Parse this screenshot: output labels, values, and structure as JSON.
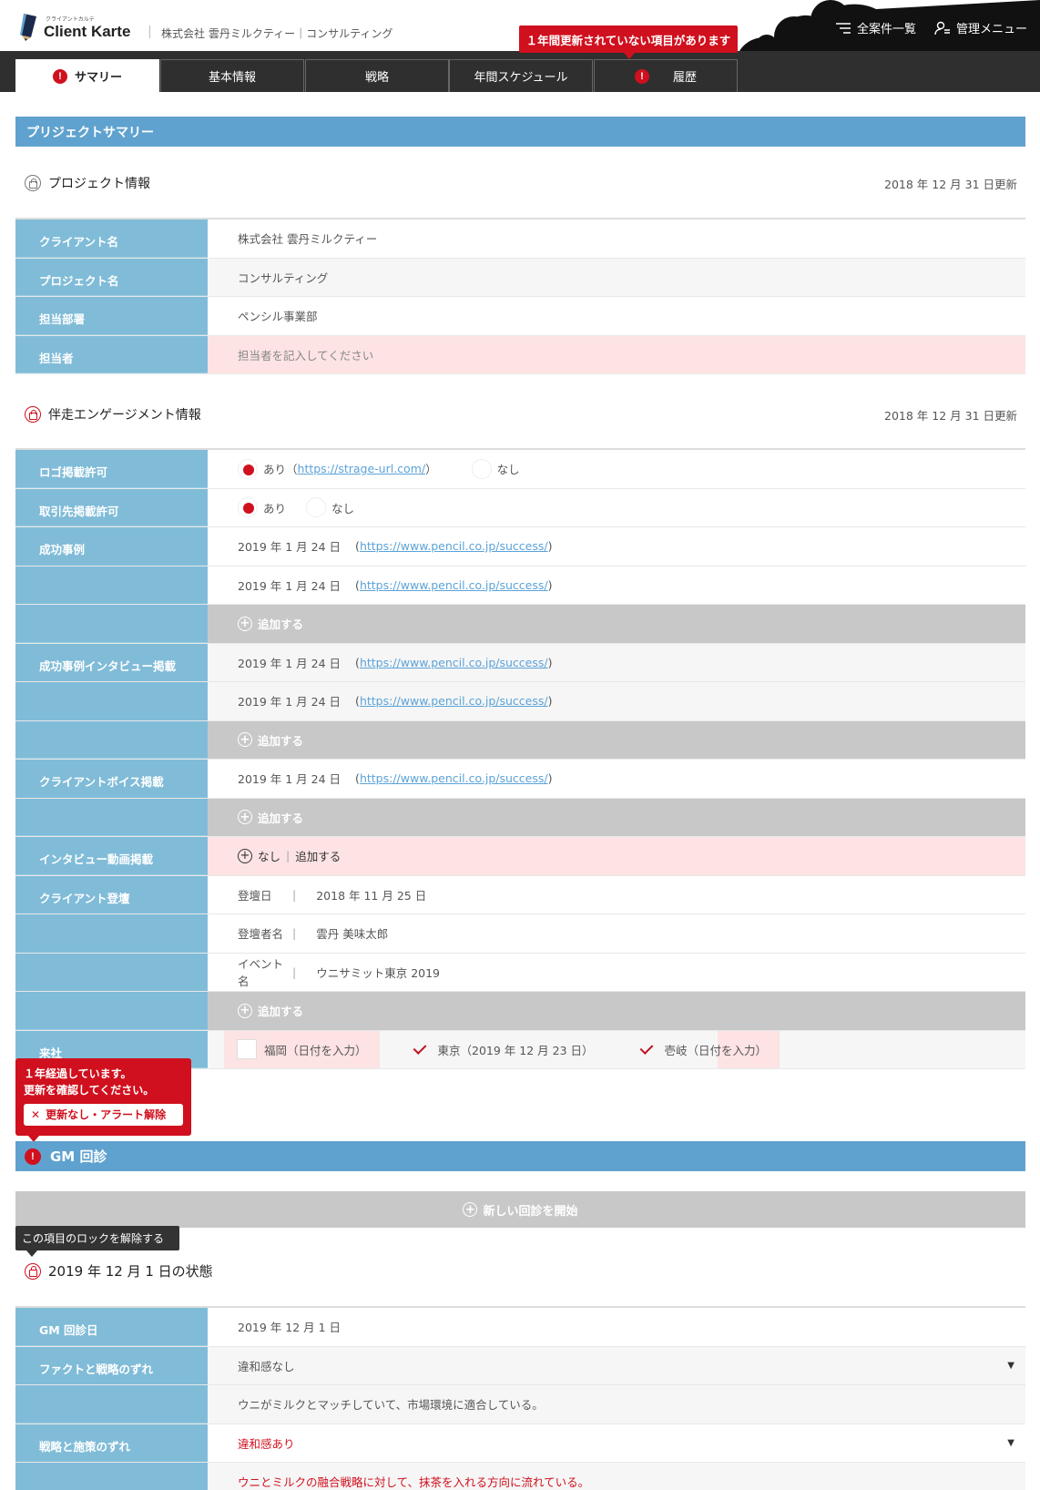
{
  "header": {
    "logo_small": "クライアントカルテ",
    "logo_text": "Client Karte",
    "subtitle": "株式会社 雲丹ミルクティー｜コンサルティング",
    "menu_all": "全案件一覧",
    "menu_admin": "管理メニュー"
  },
  "alert_banner": "１年間更新されていない項目があります",
  "tabs": [
    {
      "label": "サマリー",
      "alert": true
    },
    {
      "label": "基本情報",
      "alert": false
    },
    {
      "label": "戦略",
      "alert": false
    },
    {
      "label": "年間スケジュール",
      "alert": false
    },
    {
      "label": "履歴",
      "alert": true
    }
  ],
  "summary_title": "プリジェクトサマリー",
  "project": {
    "heading": "プロジェクト情報",
    "updated": "2018 年 12 月 31 日更新",
    "rows": [
      {
        "label": "クライアント名",
        "value": "株式会社 雲丹ミルクティー"
      },
      {
        "label": "プロジェクト名",
        "value": "コンサルティング"
      },
      {
        "label": "担当部署",
        "value": "ペンシル事業部"
      },
      {
        "label": "担当者",
        "value": "担当者を記入してください"
      }
    ]
  },
  "engagement": {
    "heading": "伴走エンゲージメント情報",
    "updated": "2018 年 12 月 31 日更新",
    "logo_label": "ロゴ掲載許可",
    "logo_yes": "あり（",
    "logo_url": "https://strage-url.com/",
    "logo_close": "）",
    "logo_no": "なし",
    "partner_label": "取引先掲載許可",
    "partner_yes": "あり",
    "partner_no": "なし",
    "success_label": "成功事例",
    "interview_label": "成功事例インタビュー掲載",
    "voice_label": "クライアントボイス掲載",
    "entry_date": "2019 年 1 月 24 日",
    "entry_url": "https://www.pencil.co.jp/success/",
    "add": "追加する",
    "video_label": "インタビュー動画掲載",
    "video_none": "なし",
    "video_add": "追加する",
    "stage_label": "クライアント登壇",
    "stage_rows": [
      {
        "k": "登壇日",
        "v": "2018 年 11 月 25 日"
      },
      {
        "k": "登壇者名",
        "v": "雲丹 美味太郎"
      },
      {
        "k": "イベント名",
        "v": "ウニサミット東京 2019"
      }
    ],
    "visit_label": "来社",
    "visits": [
      {
        "text": "福岡（日付を入力）",
        "checked": false
      },
      {
        "text": "東京（2019 年 12 月 23 日）",
        "checked": true
      },
      {
        "text": "壱岐（日付を入力）",
        "checked": true
      }
    ]
  },
  "warning": {
    "line1": "１年経過しています。",
    "line2": "更新を確認してください。",
    "button": "更新なし・アラート解除"
  },
  "gm": {
    "title": "GM 回診",
    "new_button": "新しい回診を開始",
    "unlock_tip": "この項目のロックを解除する",
    "state_heading": "2019 年 12 月 1 日の状態",
    "date_label": "GM 回診日",
    "date_value": "2019 年 12 月 1 日",
    "fact_label": "ファクトと戦略のずれ",
    "fact_value": "違和感なし",
    "fact_note": "ウニがミルクとマッチしていて、市場環境に適合している。",
    "measure_label": "戦略と施策のずれ",
    "measure_value": "違和感あり",
    "measure_note": "ウニとミルクの融合戦略に対して、抹茶を入れる方向に流れている。"
  },
  "colors": {
    "accent": "#5fa2cf",
    "alert": "#d0101e",
    "label_bg": "#80bcd8",
    "pink": "#fde3e3"
  }
}
